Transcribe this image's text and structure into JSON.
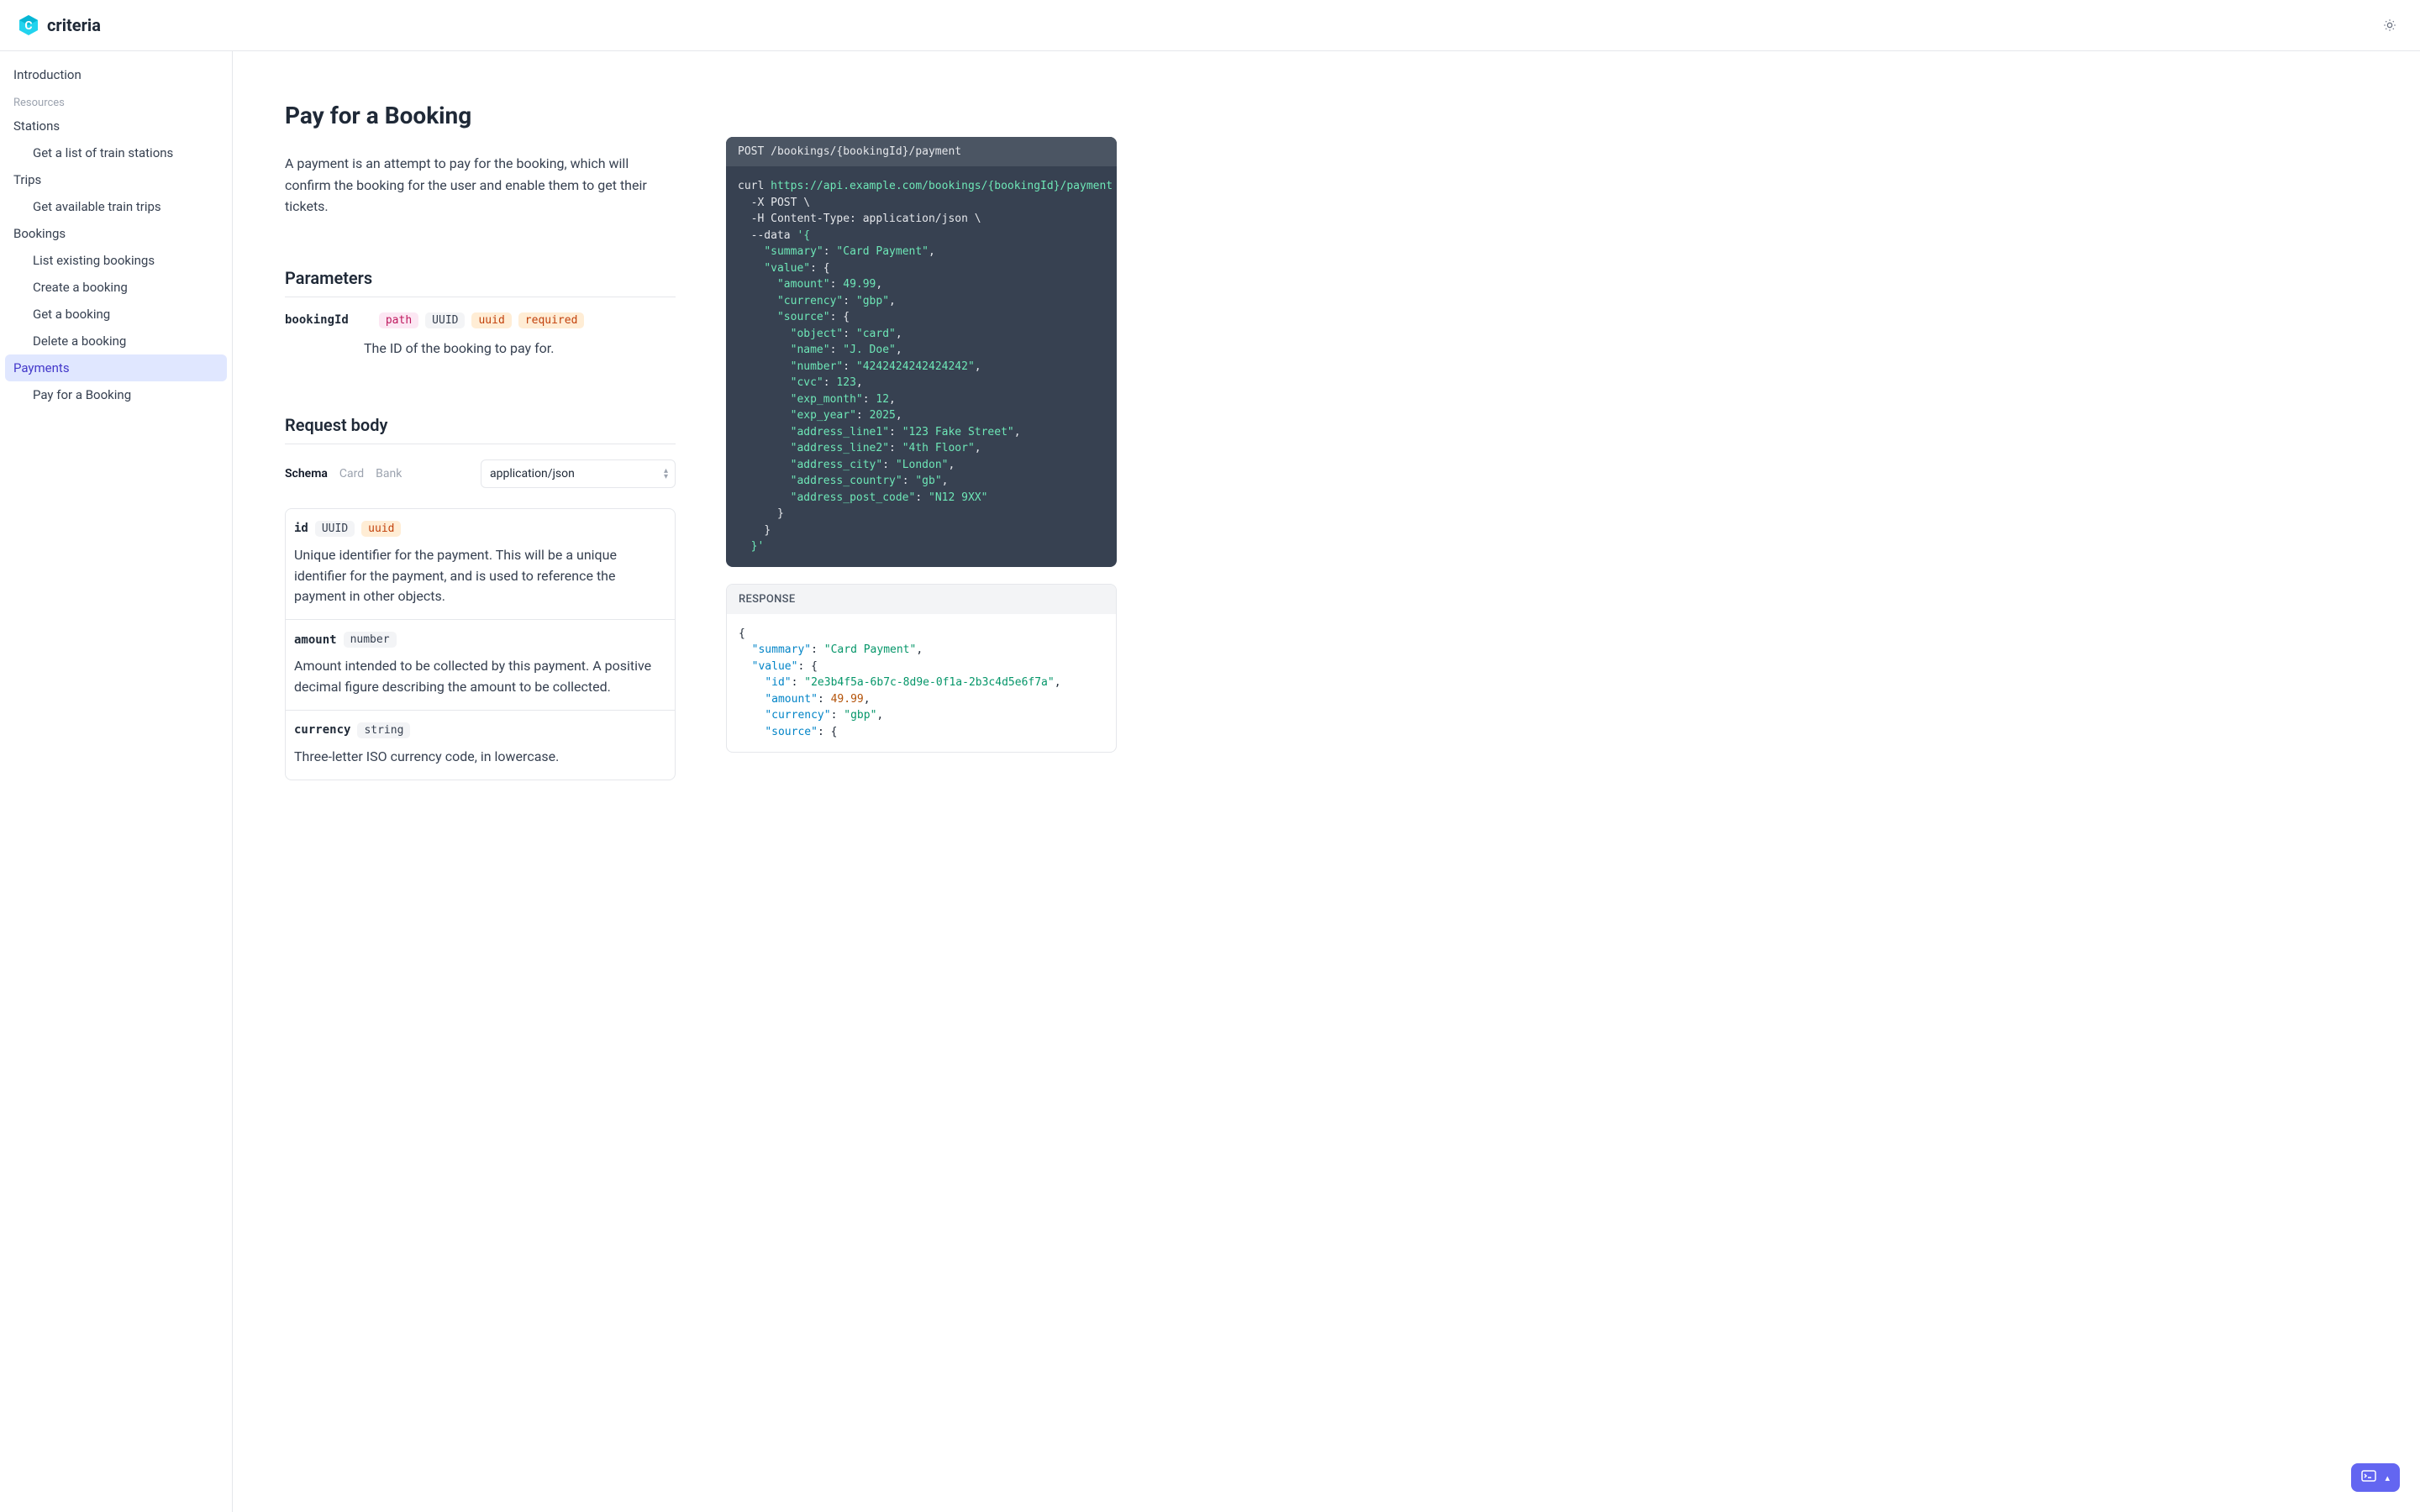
{
  "brand": {
    "name": "criteria"
  },
  "sidebar": {
    "intro": "Introduction",
    "section_label": "Resources",
    "stations": "Stations",
    "stations_sub": "Get a list of train stations",
    "trips": "Trips",
    "trips_sub": "Get available train trips",
    "bookings": "Bookings",
    "bookings_list": "List existing bookings",
    "bookings_create": "Create a booking",
    "bookings_get": "Get a booking",
    "bookings_delete": "Delete a booking",
    "payments": "Payments",
    "payments_pay": "Pay for a Booking"
  },
  "page": {
    "title": "Pay for a Booking",
    "desc": "A payment is an attempt to pay for the booking, which will confirm the booking for the user and enable them to get their tickets."
  },
  "params": {
    "heading": "Parameters",
    "bookingId": {
      "name": "bookingId",
      "badge_path": "path",
      "badge_type": "UUID",
      "badge_format": "uuid",
      "badge_required": "required",
      "desc": "The ID of the booking to pay for."
    }
  },
  "body": {
    "heading": "Request body",
    "tabs": {
      "schema": "Schema",
      "card": "Card",
      "bank": "Bank"
    },
    "content_type": "application/json",
    "fields": {
      "id": {
        "name": "id",
        "type": "UUID",
        "format": "uuid",
        "desc": "Unique identifier for the payment. This will be a unique identifier for the payment, and is used to reference the payment in other objects."
      },
      "amount": {
        "name": "amount",
        "type": "number",
        "desc": "Amount intended to be collected by this payment. A positive decimal figure describing the amount to be collected."
      },
      "currency": {
        "name": "currency",
        "type": "string",
        "desc": "Three-letter ISO currency code, in lowercase."
      }
    }
  },
  "request": {
    "method": "POST",
    "path": "/bookings/{bookingId}/payment",
    "curl_cmd": "curl",
    "url": "https://api.example.com/bookings/{bookingId}/payment",
    "line_x": "-X POST",
    "line_h": "-H Content-Type: application/json",
    "line_data": "--data",
    "payload": {
      "summary": "Card Payment",
      "amount": "49.99",
      "currency": "gbp",
      "source": {
        "object": "card",
        "name": "J. Doe",
        "number": "4242424242424242",
        "cvc": "123",
        "exp_month": "12",
        "exp_year": "2025",
        "address_line1": "123 Fake Street",
        "address_line2": "4th Floor",
        "address_city": "London",
        "address_country": "gb",
        "address_post_code": "N12 9XX"
      }
    }
  },
  "response": {
    "label": "RESPONSE",
    "summary": "Card Payment",
    "id": "2e3b4f5a-6b7c-8d9e-0f1a-2b3c4d5e6f7a",
    "amount": "49.99",
    "currency": "gbp"
  }
}
